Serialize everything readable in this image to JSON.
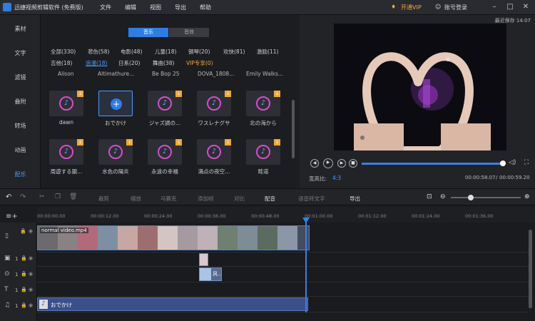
{
  "app": {
    "title": "迅捷视频剪辑软件 (免费版)",
    "menu": [
      "文件",
      "编辑",
      "视图",
      "导出",
      "帮助"
    ],
    "vip_label": "开通VIP",
    "login_label": "账号登录",
    "autosave": "最近保存 14:07"
  },
  "colors": {
    "accent": "#4a9cff",
    "vip": "#f2a93b",
    "bg": "#1b1c20"
  },
  "nav": {
    "items": [
      "素材",
      "文字",
      "滤镜",
      "叠附",
      "转场",
      "动画",
      "配乐"
    ],
    "active_index": 6
  },
  "library": {
    "tabs": [
      "音乐",
      "音效"
    ],
    "active_tab": 0,
    "categories_row1": [
      "全部(330)",
      "悲伤(58)",
      "电影(48)",
      "儿童(18)",
      "钢琴(20)",
      "欢快(81)",
      "激励(11)"
    ],
    "categories_row2": [
      "吉他(18)",
      "浪漫(18)",
      "日系(20)",
      "舞曲(38)",
      "VIP专享(0)"
    ],
    "selected_category": "浪漫(18)",
    "prev_row_labels": [
      "Alison",
      "Altimathure...",
      "Be Bop 25",
      "DOVA_1808...",
      "Emily Walks..."
    ],
    "row1": [
      "dawn",
      "おでかけ",
      "ジャズ調の...",
      "ワスレナグサ",
      "北の海から"
    ],
    "row2": [
      "周遊する銀...",
      "水色の陽炎",
      "永遠の幸福",
      "満点の夜空...",
      "畦道"
    ],
    "selected_item": "おでかけ"
  },
  "preview": {
    "aspect_label": "宽高比:",
    "aspect_value": "4:3",
    "current_time": "00:00:58.07",
    "total_time": "00:00:59.20",
    "time_separator": "/",
    "progress": 0.98
  },
  "toolbar": {
    "items": [
      "裁剪",
      "缩放",
      "马赛克",
      "添加帧",
      "对比",
      "配音",
      "语音转文字",
      "导出"
    ]
  },
  "timeline": {
    "ticks": [
      "00:00:00.00",
      "00:00:12.00",
      "00:00:24.00",
      "00:00:36.00",
      "00:00:48.00",
      "00:01:00.00",
      "00:01:12.00",
      "00:01:24.00",
      "00:01:36.00"
    ],
    "video_clip_label": "normal video.mp4",
    "pip_clip_label": "风...",
    "audio_clip_label": "おでかけ",
    "track_counts": [
      "1",
      "1",
      "1",
      "1"
    ]
  }
}
